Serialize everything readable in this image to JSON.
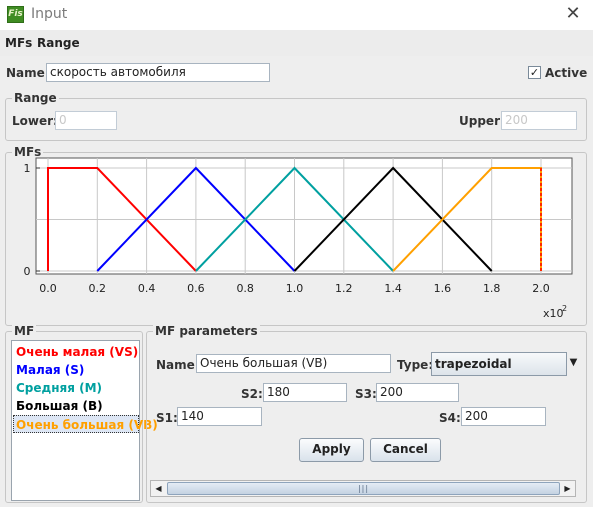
{
  "window": {
    "title": "Input",
    "app_icon": "fis-icon",
    "close_icon": "close-icon"
  },
  "menu": {
    "items": [
      "MFs",
      "Range"
    ]
  },
  "name_row": {
    "label": "Name:",
    "value": "скорость автомобиля",
    "active_label": "Active",
    "active_checked": true
  },
  "range": {
    "title": "Range",
    "lower_label": "Lower:",
    "lower_value": "0",
    "upper_label": "Upper:",
    "upper_value": "200"
  },
  "mfs_group": {
    "title": "MFs"
  },
  "chart_data": {
    "type": "line",
    "x_ticks": [
      "0.0",
      "0.2",
      "0.4",
      "0.6",
      "0.8",
      "1.0",
      "1.2",
      "1.4",
      "1.6",
      "1.8",
      "2.0"
    ],
    "y_ticks": [
      "0",
      "1"
    ],
    "x_multiplier": "x10",
    "x_multiplier_exp": "2",
    "xlim": [
      0,
      2.0
    ],
    "ylim": [
      0,
      1
    ],
    "grid": true,
    "series": [
      {
        "name": "Очень малая (VS)",
        "color": "#ff0000",
        "x": [
          0.0,
          0.0,
          0.2,
          0.6
        ],
        "y": [
          0,
          1,
          1,
          0
        ]
      },
      {
        "name": "Малая (S)",
        "color": "#0000ff",
        "x": [
          0.2,
          0.6,
          1.0
        ],
        "y": [
          0,
          1,
          0
        ]
      },
      {
        "name": "Средняя (M)",
        "color": "#00a0a0",
        "x": [
          0.6,
          1.0,
          1.4
        ],
        "y": [
          0,
          1,
          0
        ]
      },
      {
        "name": "Большая (B)",
        "color": "#000000",
        "x": [
          1.0,
          1.4,
          1.8
        ],
        "y": [
          0,
          1,
          0
        ]
      },
      {
        "name": "Очень большая (VB)",
        "color": "#ffa000",
        "x": [
          1.4,
          1.8,
          2.0,
          2.0
        ],
        "y": [
          0,
          1,
          1,
          0
        ]
      }
    ],
    "selected_marker": {
      "x": 2.0,
      "color": "#ff0000"
    }
  },
  "mf_list": {
    "title": "MF",
    "items": [
      {
        "label": "Очень малая (VS)",
        "color": "#ff0000"
      },
      {
        "label": "Малая (S)",
        "color": "#0000ff"
      },
      {
        "label": "Средняя (M)",
        "color": "#00a0a0"
      },
      {
        "label": "Большая (B)",
        "color": "#000000"
      },
      {
        "label": "Очень большая (VB)",
        "color": "#ffa000"
      }
    ],
    "selected_index": 4
  },
  "mf_params": {
    "title": "MF parameters",
    "name_label": "Name:",
    "name_value": "Очень большая (VB)",
    "type_label": "Type:",
    "type_value": "trapezoidal",
    "s1_label": "S1:",
    "s1_value": "140",
    "s2_label": "S2:",
    "s2_value": "180",
    "s3_label": "S3:",
    "s3_value": "200",
    "s4_label": "S4:",
    "s4_value": "200",
    "apply_label": "Apply",
    "cancel_label": "Cancel"
  }
}
